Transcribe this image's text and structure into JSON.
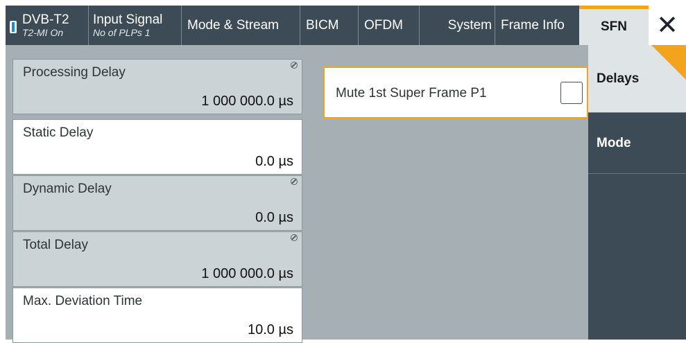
{
  "header": {
    "tabs": [
      {
        "label": "DVB-T2",
        "sub": "T2-MI On"
      },
      {
        "label": "Input Signal",
        "sub": "No of PLPs 1"
      },
      {
        "label": "Mode & Stream"
      },
      {
        "label": "BICM"
      },
      {
        "label": "OFDM"
      },
      {
        "label": "System"
      },
      {
        "label": "Frame Info"
      },
      {
        "label": "SFN"
      }
    ],
    "active_tab": "SFN",
    "close_icon": "close-x-icon"
  },
  "params": [
    {
      "label": "Processing Delay",
      "value": "1 000 000.0 µs",
      "readonly": true
    },
    {
      "label": "Static Delay",
      "value": "0.0 µs",
      "readonly": false
    },
    {
      "label": "Dynamic Delay",
      "value": "0.0 µs",
      "readonly": true
    },
    {
      "label": "Total Delay",
      "value": "1 000 000.0 µs",
      "readonly": true
    },
    {
      "label": "Max. Deviation Time",
      "value": "10.0 µs",
      "readonly": false
    }
  ],
  "mute": {
    "label": "Mute 1st Super Frame P1",
    "checked": false
  },
  "side_tabs": [
    {
      "label": "Delays"
    },
    {
      "label": "Mode"
    }
  ],
  "colors": {
    "accent": "#f3a31c",
    "tab_bg": "#3c4b55",
    "panel_bg": "#a5afb4"
  }
}
